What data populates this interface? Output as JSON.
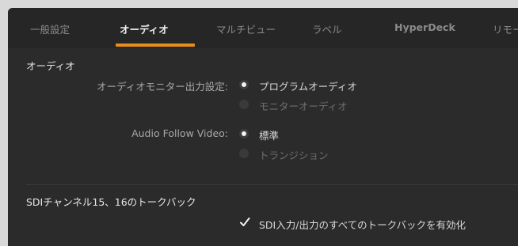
{
  "tabs": [
    {
      "label": "一般設定"
    },
    {
      "label": "オーディオ"
    },
    {
      "label": "マルチビュー"
    },
    {
      "label": "ラベル"
    },
    {
      "label": "HyperDeck"
    },
    {
      "label": "リモー"
    }
  ],
  "active_tab": "オーディオ",
  "accent_color": "#e98e1c",
  "audio": {
    "section_title": "オーディオ",
    "monitor_output": {
      "label": "オーディオモニター出力設定:",
      "options": [
        {
          "label": "プログラムオーディオ",
          "selected": true
        },
        {
          "label": "モニターオーディオ",
          "selected": false
        }
      ]
    },
    "audio_follow_video": {
      "label": "Audio Follow Video:",
      "options": [
        {
          "label": "標準",
          "selected": true
        },
        {
          "label": "トランジション",
          "selected": false
        }
      ]
    }
  },
  "talkback": {
    "section_title": "SDIチャンネル15、16のトークバック",
    "checkbox_label": "SDI入力/出力のすべてのトークバックを有効化",
    "checked": true
  }
}
